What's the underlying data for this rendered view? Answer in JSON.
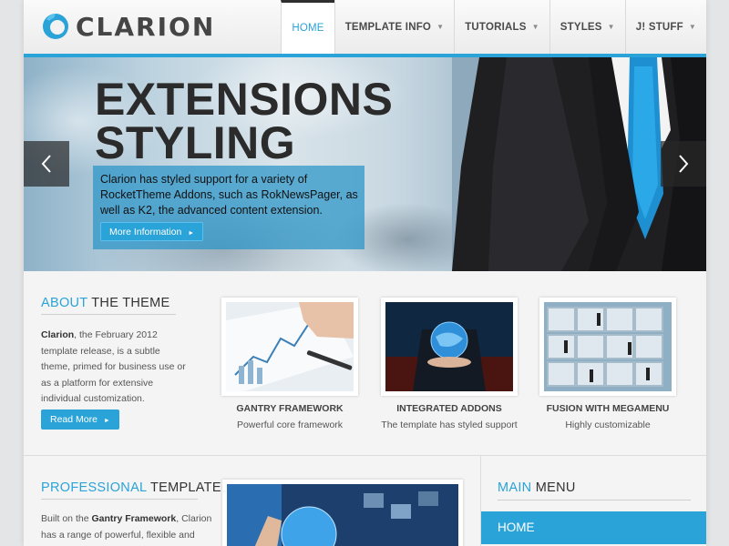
{
  "brand": {
    "name": "CLARION",
    "accent_color": "#2aa3d8"
  },
  "nav": {
    "items": [
      {
        "label": "HOME",
        "active": true,
        "has_dropdown": false
      },
      {
        "label": "TEMPLATE INFO",
        "active": false,
        "has_dropdown": true
      },
      {
        "label": "TUTORIALS",
        "active": false,
        "has_dropdown": true
      },
      {
        "label": "STYLES",
        "active": false,
        "has_dropdown": true
      },
      {
        "label": "J! STUFF",
        "active": false,
        "has_dropdown": true
      }
    ],
    "dropdown_icon": "chevron-down-icon"
  },
  "slider": {
    "title_line1": "EXTENSIONS",
    "title_line2": "STYLING",
    "description": "Clarion has styled support for a variety of RocketTheme Addons, such as RokNewsPager, as well as K2, the advanced content extension.",
    "button_label": "More Information",
    "button_icon": "arrow-right-icon",
    "prev_icon": "chevron-left-icon",
    "next_icon": "chevron-right-icon"
  },
  "about": {
    "title_accent": "ABOUT",
    "title_rest": " THE THEME",
    "text_bold": "Clarion",
    "text_rest": ", the February 2012 template release, is a subtle theme, primed for business use or as a platform for extensive individual customization.",
    "button_label": "Read More",
    "button_icon": "arrow-right-icon"
  },
  "features": [
    {
      "title": "GANTRY FRAMEWORK",
      "description": "Powerful core framework"
    },
    {
      "title": "INTEGRATED ADDONS",
      "description": "The template has styled support"
    },
    {
      "title": "FUSION WITH MEGAMENU",
      "description": "Highly customizable"
    }
  ],
  "professional": {
    "title_accent": "PROFESSIONAL",
    "title_rest": " TEMPLATE",
    "text_prefix": "Built on the ",
    "text_bold": "Gantry Framework",
    "text_rest": ", Clarion has a range of powerful, flexible and intuitive features and functions"
  },
  "main_menu": {
    "title_accent": "MAIN",
    "title_rest": " MENU",
    "items": [
      {
        "label": "HOME",
        "active": true
      }
    ]
  }
}
